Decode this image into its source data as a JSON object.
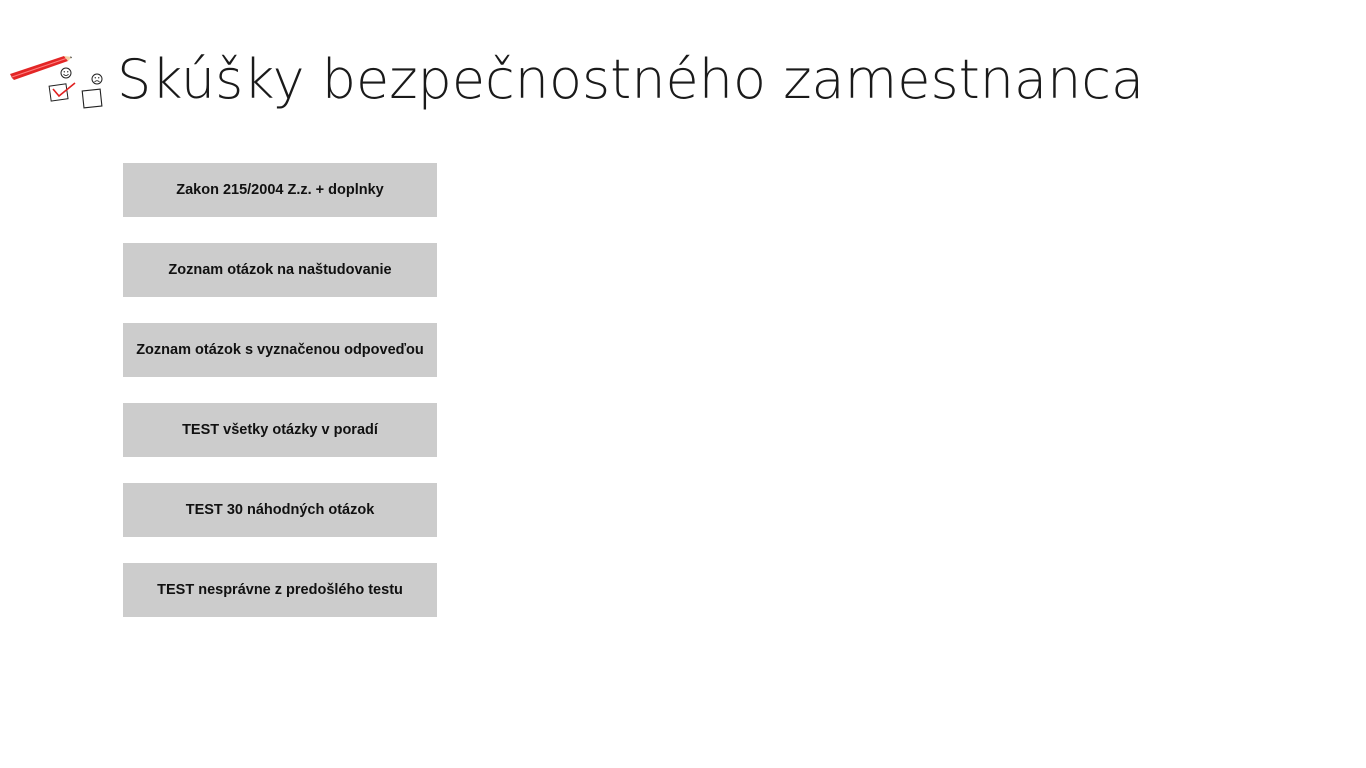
{
  "app": {
    "title": "Skúšky bezpečnostného zamestnanca",
    "logo_icon": "checklist-pencil-icon"
  },
  "menu": {
    "items": [
      {
        "label": "Zakon 215/2004 Z.z. + doplnky"
      },
      {
        "label": "Zoznam otázok na naštudovanie"
      },
      {
        "label": "Zoznam otázok s vyznačenou odpoveďou"
      },
      {
        "label": "TEST všetky otázky v poradí"
      },
      {
        "label": "TEST 30 náhodných otázok"
      },
      {
        "label": "TEST nesprávne z predošlého testu"
      }
    ]
  },
  "colors": {
    "button_bg": "#cccccc",
    "accent": "#e02020",
    "text": "#111111",
    "background": "#ffffff"
  }
}
